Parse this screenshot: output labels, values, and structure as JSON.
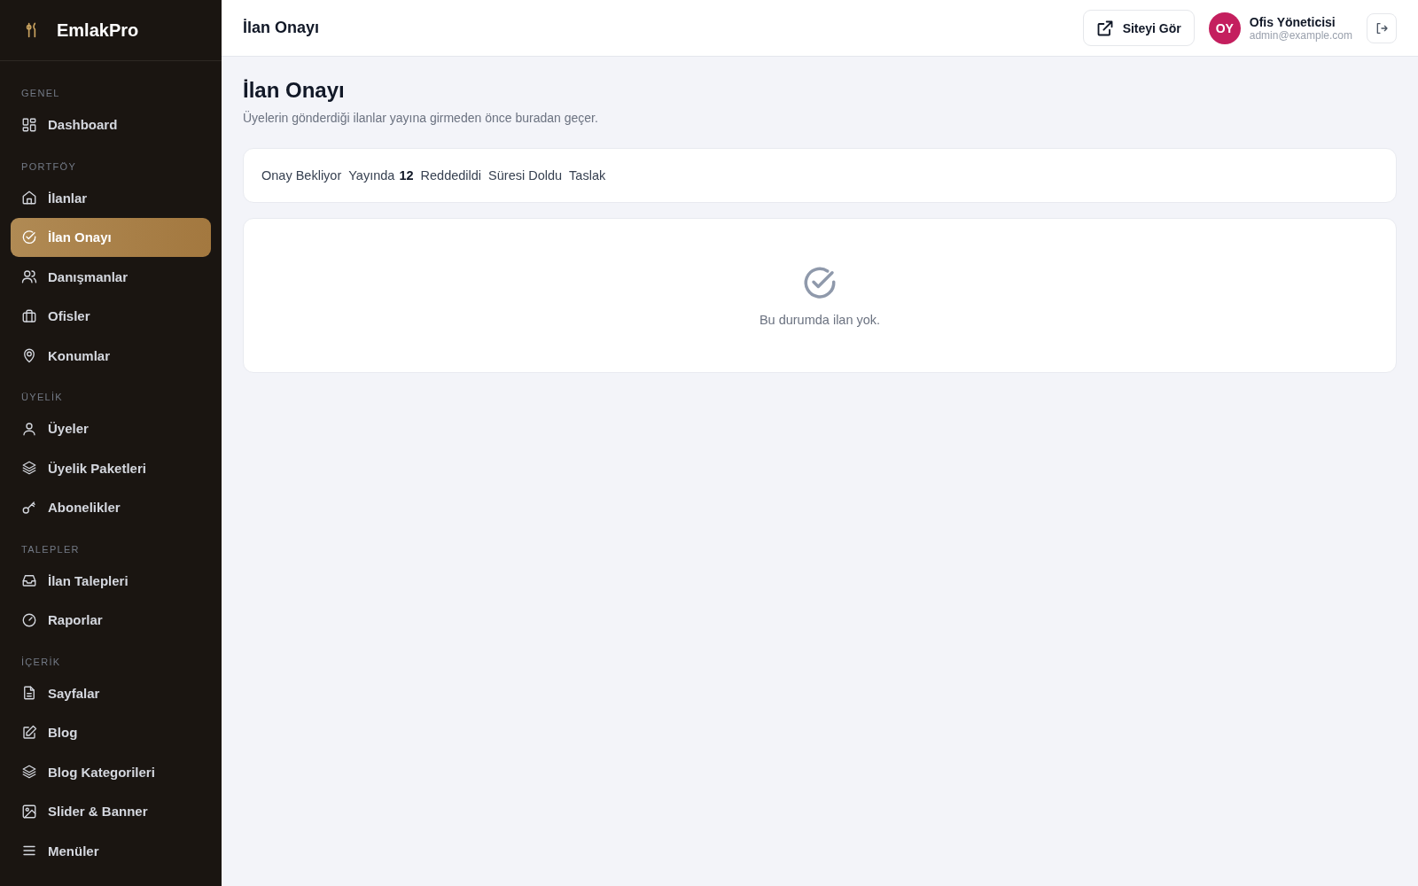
{
  "brand": {
    "name": "EmlakPro"
  },
  "sidebar": {
    "sections": [
      {
        "title": "GENEL",
        "items": [
          {
            "label": "Dashboard",
            "selected": false
          }
        ]
      },
      {
        "title": "PORTFÖY",
        "items": [
          {
            "label": "İlanlar",
            "selected": false
          },
          {
            "label": "İlan Onayı",
            "selected": true
          },
          {
            "label": "Danışmanlar",
            "selected": false
          },
          {
            "label": "Ofisler",
            "selected": false
          },
          {
            "label": "Konumlar",
            "selected": false
          }
        ]
      },
      {
        "title": "ÜYELİK",
        "items": [
          {
            "label": "Üyeler",
            "selected": false
          },
          {
            "label": "Üyelik Paketleri",
            "selected": false
          },
          {
            "label": "Abonelikler",
            "selected": false
          }
        ]
      },
      {
        "title": "TALEPLER",
        "items": [
          {
            "label": "İlan Talepleri",
            "selected": false
          },
          {
            "label": "Raporlar",
            "selected": false
          }
        ]
      },
      {
        "title": "İÇERİK",
        "items": [
          {
            "label": "Sayfalar",
            "selected": false
          },
          {
            "label": "Blog",
            "selected": false
          },
          {
            "label": "Blog Kategorileri",
            "selected": false
          },
          {
            "label": "Slider & Banner",
            "selected": false
          },
          {
            "label": "Menüler",
            "selected": false
          }
        ]
      }
    ]
  },
  "topbar": {
    "title": "İlan Onayı",
    "site_button": "Siteyi Gör",
    "user": {
      "initials": "OY",
      "name": "Ofis Yöneticisi",
      "email": "admin@example.com"
    }
  },
  "page": {
    "title": "İlan Onayı",
    "subtitle": "Üyelerin gönderdiği ilanlar yayına girmeden önce buradan geçer."
  },
  "status_tabs": [
    {
      "label": "Onay Bekliyor",
      "selected": false
    },
    {
      "label": "Yayında",
      "count": "12",
      "selected": false
    },
    {
      "label": "Reddedildi",
      "selected": false
    },
    {
      "label": "Süresi Doldu",
      "selected": false
    },
    {
      "label": "Taslak",
      "selected": false
    }
  ],
  "empty_state": {
    "message": "Bu durumda ilan yok."
  }
}
